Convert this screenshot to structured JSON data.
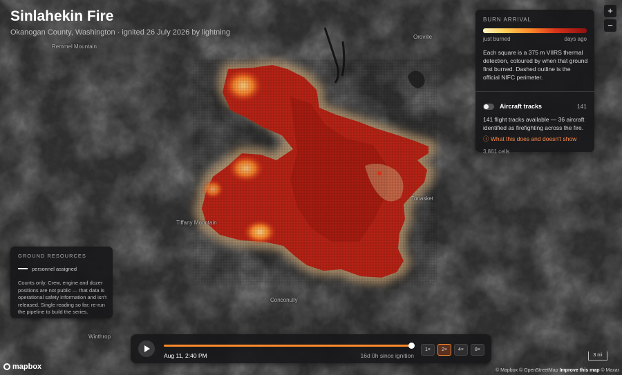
{
  "map": {
    "title": "Sinlahekin Fire",
    "subtitle": "Okanogan County, Washington · ignited 26 July 2026 by lightning",
    "place_labels": [
      {
        "name": "Remmel Mountain",
        "id": "remmel"
      },
      {
        "name": "Oroville",
        "id": "oroville"
      },
      {
        "name": "Tonasket",
        "id": "tonasket"
      },
      {
        "name": "Tiffany Mountain",
        "id": "tiffany"
      },
      {
        "name": "Conconully",
        "id": "conconully"
      },
      {
        "name": "Winthrop",
        "id": "winthrop"
      }
    ],
    "colors": {
      "fill": "#b82315",
      "halo": "#cfa878",
      "background": "#2c2c2c"
    }
  },
  "legend": {
    "header": "BURN ARRIVAL",
    "ramp_low": "just burned",
    "ramp_high": "days ago",
    "ramp_colors": [
      "#fff3c4",
      "#ffd25a",
      "#ff8a2a",
      "#d8331a",
      "#8e1010"
    ],
    "description": "Each square is a 375 m VIIRS thermal detection, coloured by when that ground first burned. Dashed outline is the official NIFC perimeter.",
    "aircraft_label": "Aircraft tracks",
    "aircraft_count": "141",
    "aircraft_toggle_on": false,
    "aircraft_description": "141 flight tracks available — 36 aircraft identified as firefighting across the fire.",
    "info_link": "ⓘ What this does and doesn't show",
    "cell_count": "3,861 cells"
  },
  "zoom": {
    "in": "+",
    "out": "−"
  },
  "ground": {
    "header": "GROUND RESOURCES",
    "line_label": "personnel assigned",
    "description": "Counts only. Crew, engine and dozer positions are not public — that data is operational safety information and isn't released. Single reading so far; re-run the pipeline to build the series."
  },
  "player": {
    "date": "Aug 11, 2:40 PM",
    "since": "16d 0h since ignition",
    "progress": 1.0,
    "speeds": [
      "1×",
      "2×",
      "4×",
      "8×"
    ],
    "active_speed": "2×"
  },
  "footer": {
    "logo": "mapbox",
    "scale": "3 mi",
    "attribution": "© Mapbox © OpenStreetMap",
    "improve": "Improve this map",
    "maxar": "© Maxar"
  }
}
